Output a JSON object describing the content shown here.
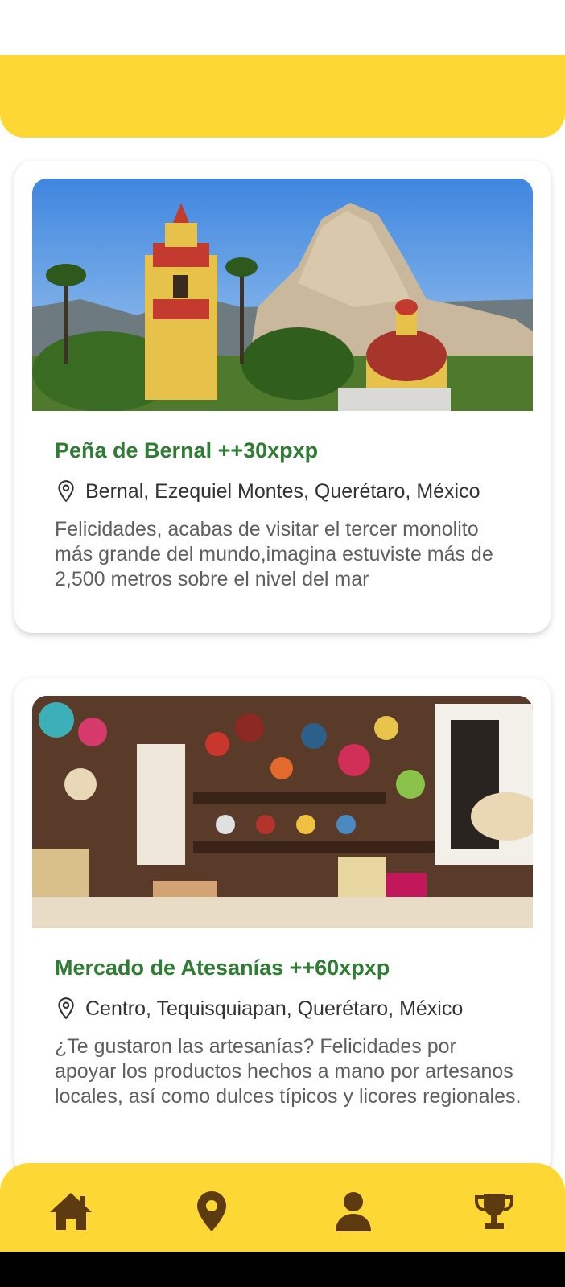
{
  "cards": [
    {
      "title": "Peña de Bernal ++30xpxp",
      "location": "Bernal, Ezequiel Montes, Querétaro, México",
      "description": "Felicidades, acabas de visitar el tercer monolito más grande del mundo,imagina estuviste más de 2,500 metros sobre el nivel del mar",
      "image": "mountain-church-photo"
    },
    {
      "title": "Mercado de Atesanías ++60xpxp",
      "location": "Centro, Tequisquiapan, Querétaro, México",
      "description": "¿Te gustaron las artesanías? Felicidades por apoyar los productos hechos a mano por artesanos locales, así como dulces típicos y licores regionales.",
      "image": "crafts-market-photo"
    }
  ],
  "bottom_nav": {
    "items": [
      "home-icon",
      "map-pin-icon",
      "person-icon",
      "trophy-icon"
    ]
  },
  "colors": {
    "accent_yellow": "#fdd835",
    "title_green": "#2e7d32",
    "nav_icon_brown": "#5d3a0f"
  }
}
